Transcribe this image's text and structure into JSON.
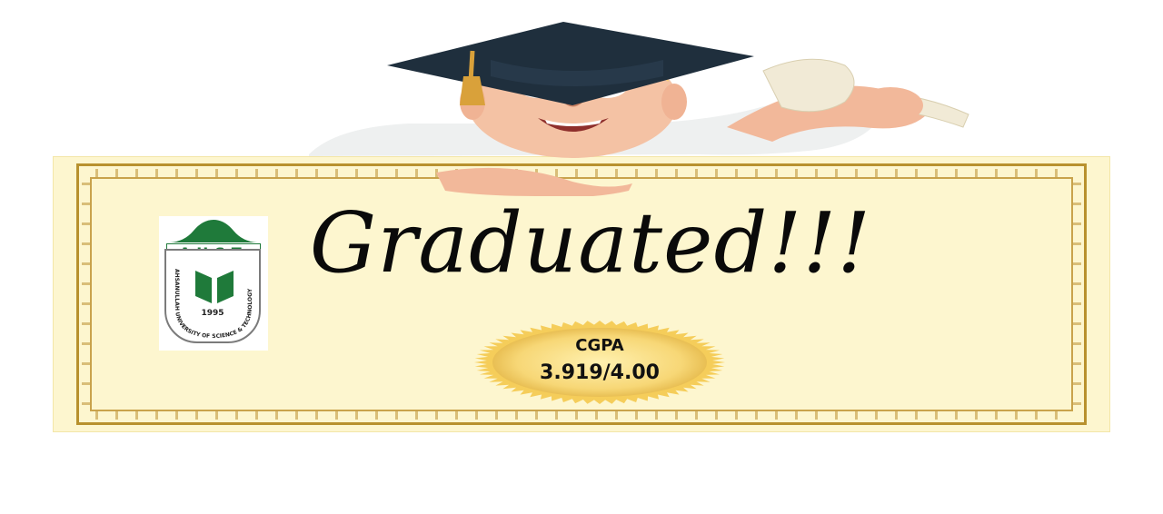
{
  "certificate": {
    "title": "Graduated!!!"
  },
  "logo": {
    "name": "AUST",
    "year": "1995",
    "arc_text": "AHSANULLAH UNIVERSITY OF SCIENCE & TECHNOLOGY",
    "color": "#1f7a3a"
  },
  "seal": {
    "label": "CGPA",
    "value": "3.919/4.00",
    "color": "#f2c94c"
  },
  "illustration": {
    "subject": "graduate-cartoon",
    "cap_color": "#1f2f3d",
    "tassel_color": "#d9a13a"
  }
}
